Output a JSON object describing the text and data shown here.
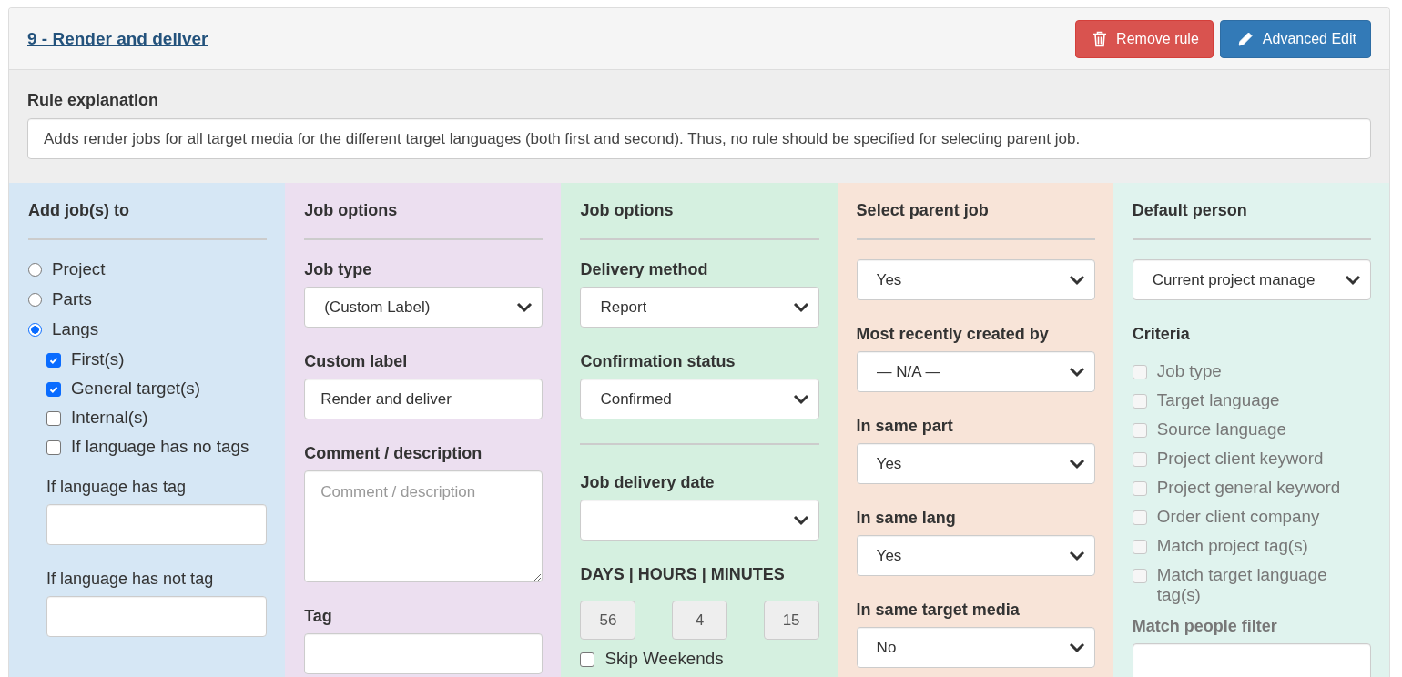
{
  "rule": {
    "title": "9 - Render and deliver",
    "buttons": [
      {
        "label": "Remove rule",
        "kind": "danger"
      },
      {
        "label": "Advanced Edit",
        "kind": "primary"
      }
    ]
  },
  "explanation": {
    "label": "Rule explanation",
    "value": "Adds render jobs for all target media for the different target languages (both first and second). Thus, no rule should be specified for selecting parent job."
  },
  "columns": [
    {
      "heading": "Add job(s) to",
      "color": "#d6e7f5",
      "fields": [
        {
          "kind": "radio",
          "label": "Project",
          "selected": false
        },
        {
          "kind": "radio",
          "label": "Parts",
          "selected": false
        },
        {
          "kind": "radio",
          "label": "Langs",
          "selected": true,
          "children": [
            {
              "kind": "checkbox",
              "label": "First(s)",
              "checked": true,
              "disabled": false
            },
            {
              "kind": "checkbox",
              "label": "General target(s)",
              "checked": true,
              "disabled": false
            },
            {
              "kind": "checkbox",
              "label": "Internal(s)",
              "checked": false,
              "disabled": false
            },
            {
              "kind": "checkbox",
              "label": "If language has no tags",
              "checked": false,
              "disabled": false
            },
            {
              "kind": "input",
              "label": "If language has tag"
            },
            {
              "kind": "input",
              "label": "If language has not tag"
            }
          ]
        }
      ]
    },
    {
      "heading": "Job options",
      "color": "#ecdff0",
      "fields": [
        {
          "kind": "select",
          "label": "Job type",
          "value": "(Custom Label)"
        },
        {
          "kind": "input",
          "label": "Custom label",
          "value": "Render and deliver"
        },
        {
          "kind": "textarea",
          "label": "Comment / description",
          "placeholder": "Comment / description"
        },
        {
          "kind": "input",
          "label": "Tag"
        }
      ]
    },
    {
      "heading": "Job options",
      "color": "#d5f0e0",
      "fields": [
        {
          "kind": "select",
          "label": "Delivery method",
          "value": "Report"
        },
        {
          "kind": "select",
          "label": "Confirmation status",
          "value": "Confirmed"
        },
        {
          "kind": "divider"
        },
        {
          "kind": "select",
          "label": "Job delivery date"
        },
        {
          "kind": "duration",
          "label": "DAYS | HOURS | MINUTES",
          "values": [
            "56",
            "4",
            "15"
          ]
        },
        {
          "kind": "checkbox",
          "label": "Skip Weekends",
          "checked": false,
          "disabled": false
        }
      ]
    },
    {
      "heading": "Select parent job",
      "color": "#f8e4d8",
      "fields": [
        {
          "kind": "select",
          "value": "Yes"
        },
        {
          "kind": "select",
          "label": "Most recently created by",
          "value": "— N/A —"
        },
        {
          "kind": "select",
          "label": "In same part",
          "value": "Yes"
        },
        {
          "kind": "select",
          "label": "In same lang",
          "value": "Yes"
        },
        {
          "kind": "select",
          "label": "In same target media",
          "value": "No"
        }
      ]
    },
    {
      "heading": "Default person",
      "color": "#e0f3ee",
      "fields": [
        {
          "kind": "select",
          "value": "Current project manage"
        },
        {
          "kind": "caption",
          "label": "Criteria"
        },
        {
          "kind": "checkbox",
          "label": "Job type",
          "checked": false,
          "disabled": true
        },
        {
          "kind": "checkbox",
          "label": "Target language",
          "checked": false,
          "disabled": true
        },
        {
          "kind": "checkbox",
          "label": "Source language",
          "checked": false,
          "disabled": true
        },
        {
          "kind": "checkbox",
          "label": "Project client keyword",
          "checked": false,
          "disabled": true
        },
        {
          "kind": "checkbox",
          "label": "Project general keyword",
          "checked": false,
          "disabled": true
        },
        {
          "kind": "checkbox",
          "label": "Order client company",
          "checked": false,
          "disabled": true
        },
        {
          "kind": "checkbox",
          "label": "Match project tag(s)",
          "checked": false,
          "disabled": true
        },
        {
          "kind": "checkbox",
          "label": "Match target language tag(s)",
          "checked": false,
          "disabled": true
        },
        {
          "kind": "input",
          "label": "Match people filter",
          "disabled": true
        }
      ]
    }
  ]
}
